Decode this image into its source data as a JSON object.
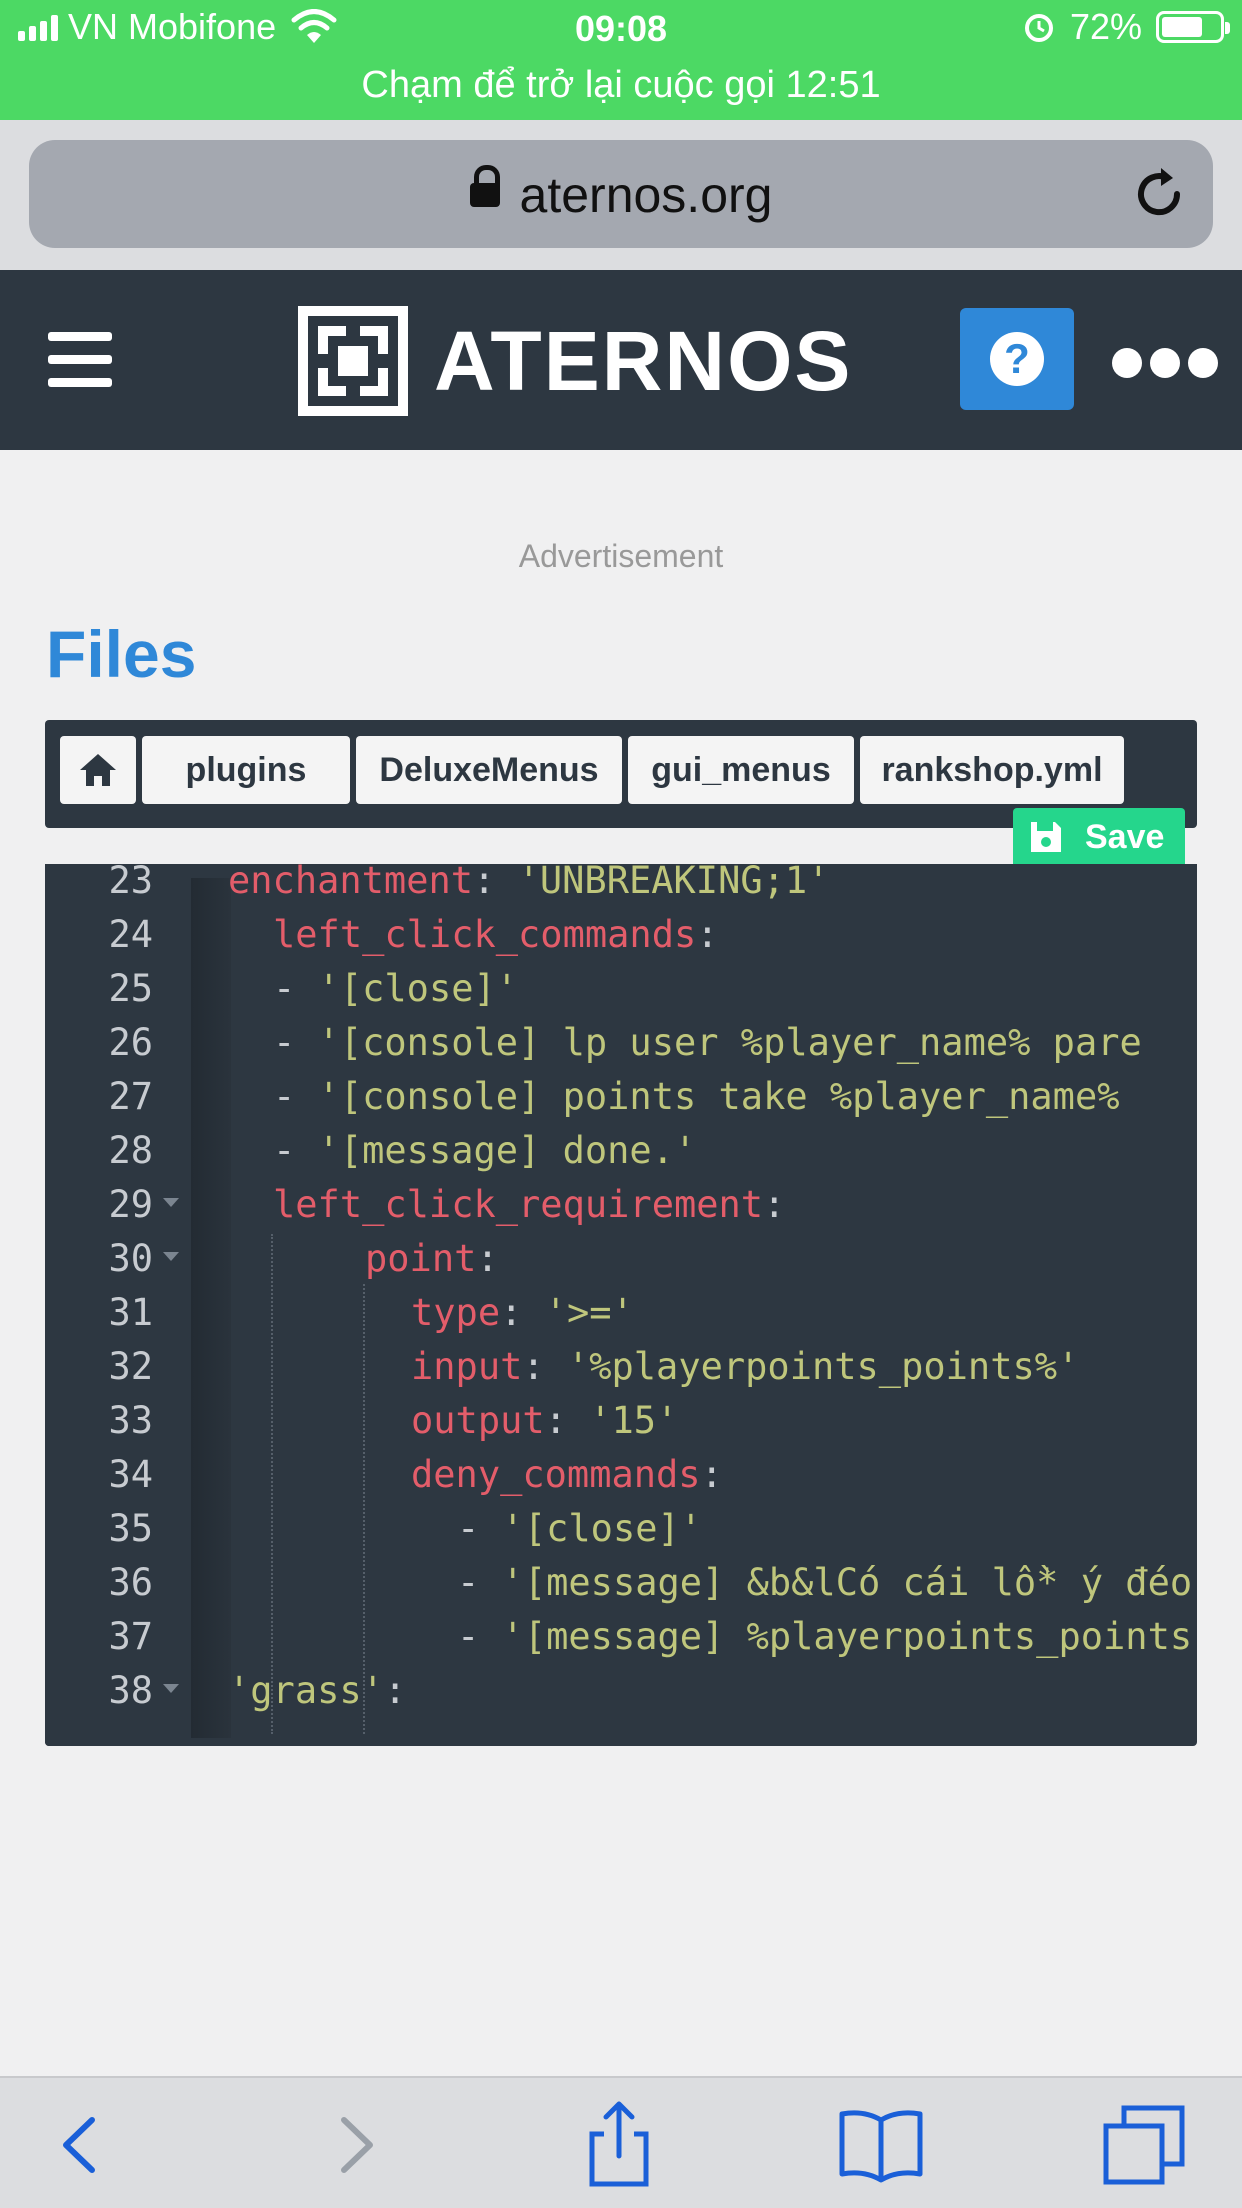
{
  "status_bar": {
    "carrier": "VN Mobifone",
    "time": "09:08",
    "battery": "72%",
    "battery_level": 0.72,
    "call_banner": "Chạm để trở lại cuộc gọi 12:51"
  },
  "browser": {
    "url": "aternos.org"
  },
  "header": {
    "logo_text": "ATERNOS",
    "help_label": "?"
  },
  "page": {
    "advertisement": "Advertisement",
    "title": "Files",
    "breadcrumb": [
      "plugins",
      "DeluxeMenus",
      "gui_menus",
      "rankshop.yml"
    ],
    "save_label": "Save"
  },
  "editor": {
    "lines": [
      {
        "n": "23",
        "key": "enchantment",
        "value": " 'UNBREAKING;1'"
      },
      {
        "n": "24",
        "key": "left_click_commands",
        "value": ""
      },
      {
        "n": "25",
        "dash": "- ",
        "value": "'[close]'"
      },
      {
        "n": "26",
        "dash": "- ",
        "value": "'[console] lp user %player_name% pare"
      },
      {
        "n": "27",
        "dash": "- ",
        "value": "'[console] points take %player_name%"
      },
      {
        "n": "28",
        "dash": "- ",
        "value": "'[message] done.'"
      },
      {
        "n": "29",
        "key": "left_click_requirement",
        "value": ""
      },
      {
        "n": "30",
        "key": "point",
        "value": ""
      },
      {
        "n": "31",
        "key": "type",
        "value": " '>='"
      },
      {
        "n": "32",
        "key": "input",
        "value": " '%playerpoints_points%'"
      },
      {
        "n": "33",
        "key": "output",
        "value": " '15'"
      },
      {
        "n": "34",
        "key": "deny_commands",
        "value": ""
      },
      {
        "n": "35",
        "dash": "- ",
        "value": "'[close]'"
      },
      {
        "n": "36",
        "dash": "- ",
        "value": "'[message] &b&lCó cái lồ* ý đéo"
      },
      {
        "n": "37",
        "dash": "- ",
        "value": "'[message] %playerpoints_points"
      },
      {
        "n": "38",
        "value": "'grass'"
      }
    ]
  }
}
